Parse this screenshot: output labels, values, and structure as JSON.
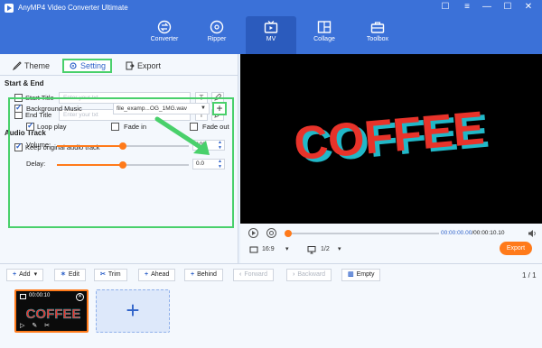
{
  "app": {
    "title": "AnyMP4 Video Converter Ultimate"
  },
  "window_controls": [
    "☐",
    "≡",
    "—",
    "☐",
    "✕"
  ],
  "nav": {
    "tabs": [
      {
        "label": "Converter",
        "icon": "converter-icon"
      },
      {
        "label": "Ripper",
        "icon": "ripper-icon"
      },
      {
        "label": "MV",
        "icon": "mv-icon",
        "active": true
      },
      {
        "label": "Collage",
        "icon": "collage-icon"
      },
      {
        "label": "Toolbox",
        "icon": "toolbox-icon"
      }
    ]
  },
  "subtabs": {
    "theme": "Theme",
    "setting": "Setting",
    "export": "Export"
  },
  "start_end": {
    "heading": "Start & End",
    "start_title_label": "Start Title",
    "start_title_placeholder": "Enter your txt",
    "end_title_label": "End Title",
    "end_title_placeholder": "Enter your txt",
    "text_button": "T"
  },
  "audio": {
    "heading": "Audio Track",
    "keep_original_label": "Keep original audio track",
    "keep_original_checked": true,
    "background_music_label": "Background Music",
    "background_music_checked": true,
    "music_file": "file_examp...OG_1MG.wav",
    "add_button": "+",
    "loop_play_label": "Loop play",
    "loop_play_checked": true,
    "fade_in_label": "Fade in",
    "fade_in_checked": false,
    "fade_out_label": "Fade out",
    "fade_out_checked": false,
    "volume_label": "Volume:",
    "volume_value": "100",
    "volume_level": 0.5,
    "delay_label": "Delay:",
    "delay_value": "0.0",
    "delay_level": 0.5
  },
  "preview": {
    "text": "COFFEE",
    "colors": {
      "main": "#e8332a",
      "shadow": "#21b8c8"
    }
  },
  "player": {
    "current_time": "00:00:00.00",
    "total_time": "00:00:10.10",
    "time_separator": "/",
    "aspect": "16:9",
    "screen": "1/2",
    "export_label": "Export",
    "progress": 0
  },
  "toolbar": {
    "add": "Add",
    "edit": "Edit",
    "trim": "Trim",
    "ahead": "Ahead",
    "behind": "Behind",
    "forward": "Forward",
    "backward": "Backward",
    "empty": "Empty",
    "page": "1 / 1"
  },
  "clip": {
    "time": "00:00:10",
    "thumb_text": "COFFEE"
  },
  "colors": {
    "brand_blue": "#3b71d8",
    "accent_orange": "#ff7a1a",
    "highlight_green": "#49d06b"
  }
}
